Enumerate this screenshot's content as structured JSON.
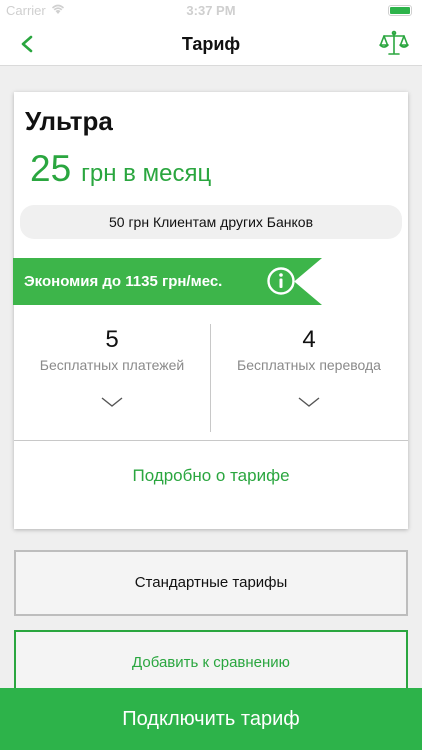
{
  "status_bar": {
    "carrier": "Carrier",
    "time": "3:37 PM",
    "battery_level": 1.0
  },
  "nav": {
    "title": "Тариф",
    "back_icon": "chevron-left-icon",
    "compare_icon": "scales-icon",
    "accent_color": "#2aa63f"
  },
  "tariff": {
    "name": "Ультра",
    "price": "25",
    "price_unit": "грн в месяц",
    "other_banks_note": "50 грн Клиентам других Банков",
    "savings": "Экономия до 1135 грн/мес.",
    "stats": [
      {
        "value": "5",
        "label": "Бесплатных платежей"
      },
      {
        "value": "4",
        "label": "Бесплатных перевода"
      }
    ],
    "details_link": "Подробно о тарифе"
  },
  "buttons": {
    "standard": "Стандартные тарифы",
    "compare": "Добавить к сравнению",
    "connect": "Подключить тариф"
  },
  "colors": {
    "brand_green": "#2db34a",
    "text_green": "#2aa63f",
    "background": "#efefef"
  }
}
